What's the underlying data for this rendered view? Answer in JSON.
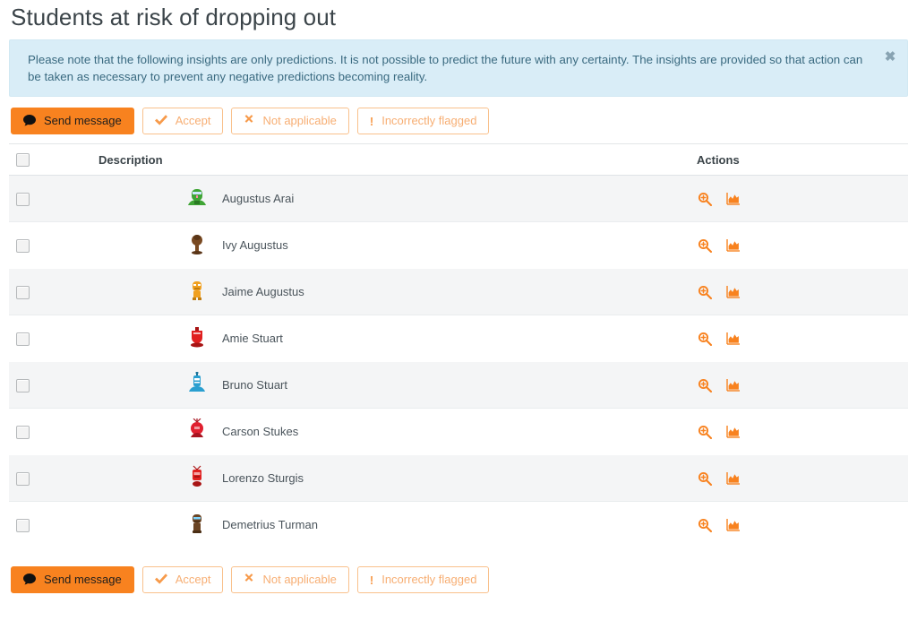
{
  "page": {
    "title": "Students at risk of dropping out"
  },
  "alert": {
    "message": "Please note that the following insights are only predictions. It is not possible to predict the future with any certainty. The insights are provided so that action can be taken as necessary to prevent any negative predictions becoming reality.",
    "close_label": "✖",
    "background_color": "#d9edf7",
    "text_color": "#31708f"
  },
  "toolbar": {
    "buttons": [
      {
        "label": "Send message",
        "icon": "comment-icon",
        "glyph": "●",
        "style": "primary"
      },
      {
        "label": "Accept",
        "icon": "check-icon",
        "glyph": "✔",
        "style": "outline"
      },
      {
        "label": "Not applicable",
        "icon": "cross-icon",
        "glyph": "✖",
        "style": "outline"
      },
      {
        "label": "Incorrectly flagged",
        "icon": "exclamation-icon",
        "glyph": "!",
        "style": "outline"
      }
    ],
    "primary_color": "#f8821f",
    "outline_border_color": "#f9c18c",
    "outline_text_color": "#f7ae73"
  },
  "table": {
    "headers": {
      "select": "",
      "description": "Description",
      "actions": "Actions"
    },
    "action_icons": [
      {
        "name": "magnifier-plus-icon",
        "title": "View prediction details"
      },
      {
        "name": "area-chart-icon",
        "title": "View insight report"
      }
    ],
    "rows": [
      {
        "name": "Augustus Arai",
        "avatar_color": "#3fa535",
        "avatar_dark": "#2a7a24",
        "avatar_type": "monster-1"
      },
      {
        "name": "Ivy Augustus",
        "avatar_color": "#7a4a22",
        "avatar_dark": "#5a3517",
        "avatar_type": "monster-2"
      },
      {
        "name": "Jaime Augustus",
        "avatar_color": "#f0a020",
        "avatar_dark": "#c07c10",
        "avatar_type": "monster-3"
      },
      {
        "name": "Amie Stuart",
        "avatar_color": "#e02020",
        "avatar_dark": "#a81414",
        "avatar_type": "monster-4"
      },
      {
        "name": "Bruno Stuart",
        "avatar_color": "#2a9fd0",
        "avatar_dark": "#1b7399",
        "avatar_type": "monster-5"
      },
      {
        "name": "Carson Stukes",
        "avatar_color": "#e02030",
        "avatar_dark": "#a81420",
        "avatar_type": "monster-6"
      },
      {
        "name": "Lorenzo Sturgis",
        "avatar_color": "#e02020",
        "avatar_dark": "#a81414",
        "avatar_type": "monster-7"
      },
      {
        "name": "Demetrius Turman",
        "avatar_color": "#6b4423",
        "avatar_dark": "#4a2e15",
        "avatar_type": "monster-8"
      }
    ]
  }
}
